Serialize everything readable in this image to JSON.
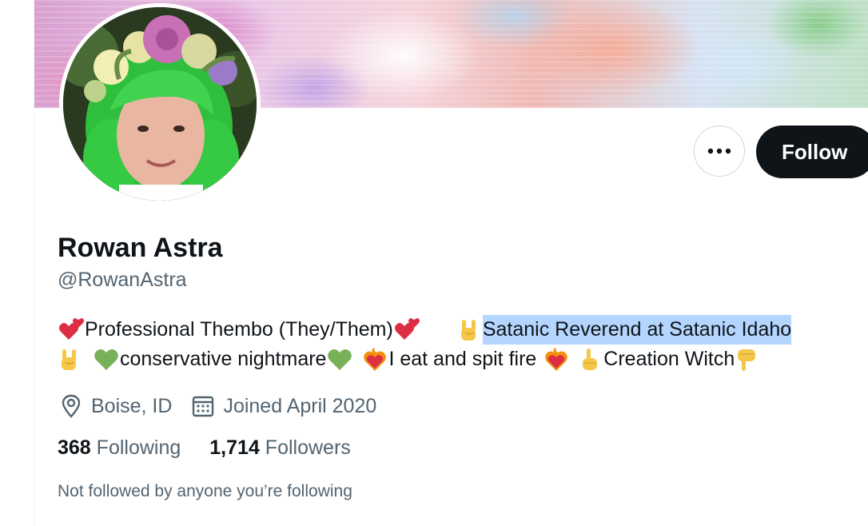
{
  "profile": {
    "display_name": "Rowan Astra",
    "handle": "@RowanAstra",
    "more_label": "•••",
    "follow_label": "Follow"
  },
  "bio": {
    "line1": {
      "part1": "Professional Thembo (They/Them)",
      "part2": "Satanic Reverend at Satanic Idaho"
    },
    "line2": {
      "part1": "conservative nightmare",
      "part2": "I eat and spit fire",
      "part3": "Creation Witch"
    },
    "emojis": [
      "two-hearts-icon",
      "sign-of-horns-icon",
      "green-heart-icon",
      "heart-on-fire-icon",
      "index-pointing-up-icon",
      "backhand-index-pointing-down-icon"
    ]
  },
  "meta": {
    "location": "Boise, ID",
    "joined": "Joined April 2020",
    "location_icon": "location-pin-icon",
    "calendar_icon": "calendar-icon"
  },
  "stats": {
    "following_count": "368",
    "following_label": "Following",
    "followers_count": "1,714",
    "followers_label": "Followers"
  },
  "footer": {
    "not_followed": "Not followed by anyone you’re following"
  },
  "colors": {
    "text_primary": "#0f1419",
    "text_secondary": "#536471",
    "button_dark": "#0f1419",
    "selection_highlight": "#b4d5fe",
    "hair_green": "#3ec94a"
  }
}
